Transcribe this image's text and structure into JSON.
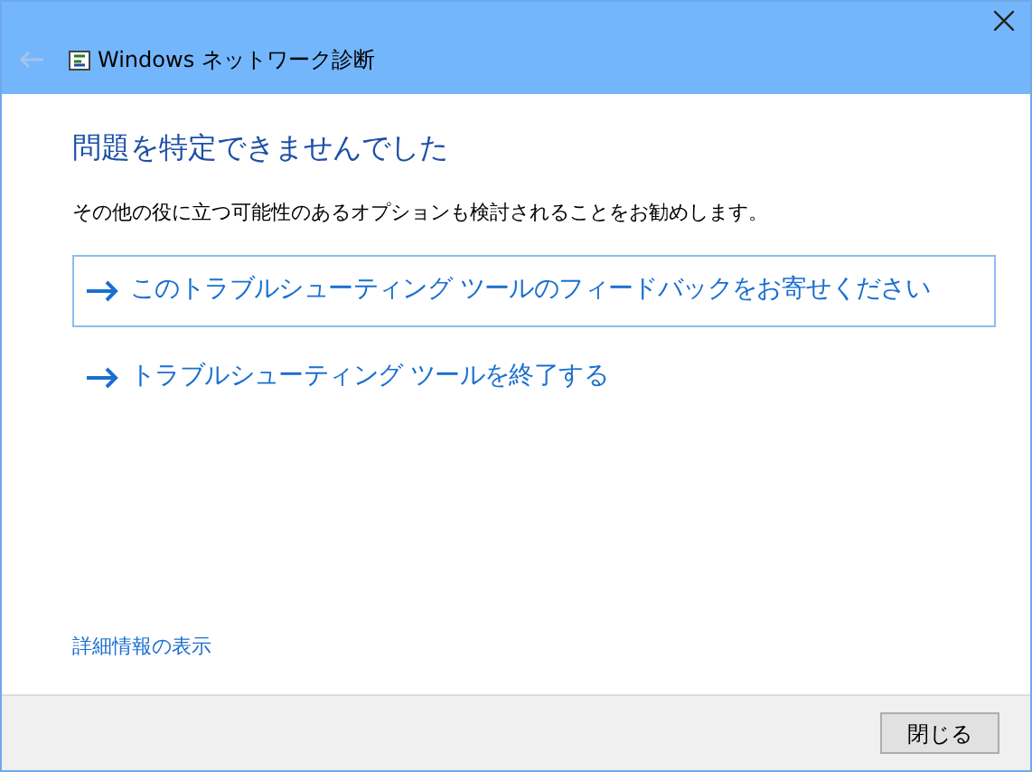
{
  "window": {
    "title": "Windows ネットワーク診断"
  },
  "heading": "問題を特定できませんでした",
  "description": "その他の役に立つ可能性のあるオプションも検討されることをお勧めします。",
  "options": [
    {
      "label": "このトラブルシューティング ツールのフィードバックをお寄せください",
      "selected": true
    },
    {
      "label": "トラブルシューティング ツールを終了する",
      "selected": false
    }
  ],
  "details_link": "詳細情報の表示",
  "buttons": [
    "閉じる"
  ]
}
